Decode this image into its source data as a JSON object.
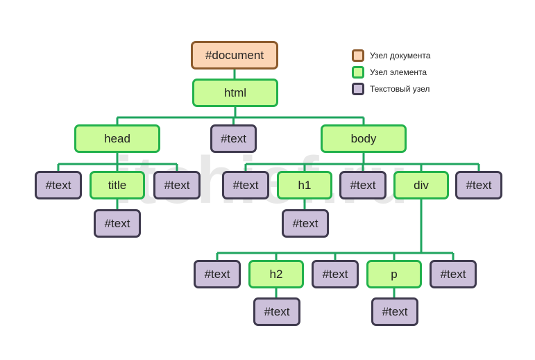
{
  "watermark": "itchief.ru",
  "colors": {
    "document_fill": "#fcd5b5",
    "document_border": "#8c5a2c",
    "element_fill": "#ccfb9a",
    "element_border": "#22b14c",
    "text_fill": "#ccc0da",
    "text_border": "#3f3a4e",
    "connector": "#1fa55f"
  },
  "legend": [
    {
      "type": "doc",
      "label": "Узел документа"
    },
    {
      "type": "el",
      "label": "Узел элемента"
    },
    {
      "type": "txt",
      "label": "Текстовый узел"
    }
  ],
  "nodes": [
    {
      "id": "document",
      "label": "#document",
      "type": "doc",
      "parent": null
    },
    {
      "id": "html",
      "label": "html",
      "type": "el",
      "parent": "document"
    },
    {
      "id": "head",
      "label": "head",
      "type": "el",
      "parent": "html"
    },
    {
      "id": "text-html",
      "label": "#text",
      "type": "txt",
      "parent": "html"
    },
    {
      "id": "body",
      "label": "body",
      "type": "el",
      "parent": "html"
    },
    {
      "id": "text-head-1",
      "label": "#text",
      "type": "txt",
      "parent": "head"
    },
    {
      "id": "title",
      "label": "title",
      "type": "el",
      "parent": "head"
    },
    {
      "id": "text-head-2",
      "label": "#text",
      "type": "txt",
      "parent": "head"
    },
    {
      "id": "text-title",
      "label": "#text",
      "type": "txt",
      "parent": "title"
    },
    {
      "id": "text-body-1",
      "label": "#text",
      "type": "txt",
      "parent": "body"
    },
    {
      "id": "h1",
      "label": "h1",
      "type": "el",
      "parent": "body"
    },
    {
      "id": "text-body-2",
      "label": "#text",
      "type": "txt",
      "parent": "body"
    },
    {
      "id": "div",
      "label": "div",
      "type": "el",
      "parent": "body"
    },
    {
      "id": "text-body-3",
      "label": "#text",
      "type": "txt",
      "parent": "body"
    },
    {
      "id": "text-h1",
      "label": "#text",
      "type": "txt",
      "parent": "h1"
    },
    {
      "id": "text-div-1",
      "label": "#text",
      "type": "txt",
      "parent": "div"
    },
    {
      "id": "h2",
      "label": "h2",
      "type": "el",
      "parent": "div"
    },
    {
      "id": "text-div-2",
      "label": "#text",
      "type": "txt",
      "parent": "div"
    },
    {
      "id": "p",
      "label": "p",
      "type": "el",
      "parent": "div"
    },
    {
      "id": "text-div-3",
      "label": "#text",
      "type": "txt",
      "parent": "div"
    },
    {
      "id": "text-h2",
      "label": "#text",
      "type": "txt",
      "parent": "h2"
    },
    {
      "id": "text-p",
      "label": "#text",
      "type": "txt",
      "parent": "p"
    }
  ]
}
